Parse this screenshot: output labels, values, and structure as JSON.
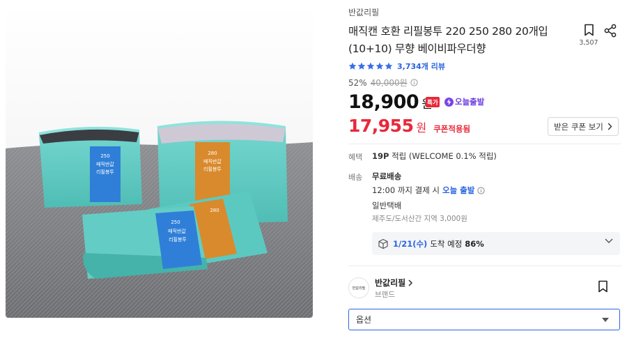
{
  "product_image": {
    "alt": "매직캔 호환 리필봉투 product photo",
    "box_labels": [
      "250",
      "매직반값",
      "리필봉투"
    ]
  },
  "brand_link": "반값리필",
  "title": "매직캔 호환 리필봉투 220 250 280 20개입 (10+10) 무향 베이비파우더향",
  "bookmark": {
    "count": "3,507",
    "icon": "bookmark-icon"
  },
  "share": {
    "icon": "share-icon"
  },
  "rating": {
    "stars": 5,
    "review_text": "3,734개 리뷰"
  },
  "discount": {
    "rate": "52%",
    "original_price": "40,000원"
  },
  "price": {
    "value": "18,900",
    "unit": "원",
    "hot_badge": "특가",
    "today_badge": "오늘출발"
  },
  "coupon_price": {
    "value": "17,955",
    "unit": "원",
    "tag": "쿠폰적용됨"
  },
  "coupon_button": {
    "label": "받은 쿠폰 보기"
  },
  "benefit": {
    "label": "혜택",
    "points": "19P",
    "text": "적립 (WELCOME 0.1% 적립)"
  },
  "shipping": {
    "label": "배송",
    "fee": "무료배송",
    "cutoff_time": "12:00 까지 결제 시",
    "cutoff_highlight": "오늘 출발",
    "method": "일반택배",
    "extra_fee": "제주도/도서산간 지역 3,000원"
  },
  "delivery_estimate": {
    "date": "1/21(수)",
    "text": "도착 예정",
    "percent": "86%"
  },
  "seller": {
    "logo_text": "반값리필",
    "name": "반값리필",
    "type": "브랜드"
  },
  "option_select": {
    "placeholder": "옵션"
  },
  "colors": {
    "accent_blue": "#2a64e1",
    "sale_red": "#e8283a",
    "badge_purple": "#7a44e8",
    "star_blue": "#3a6ee8"
  }
}
